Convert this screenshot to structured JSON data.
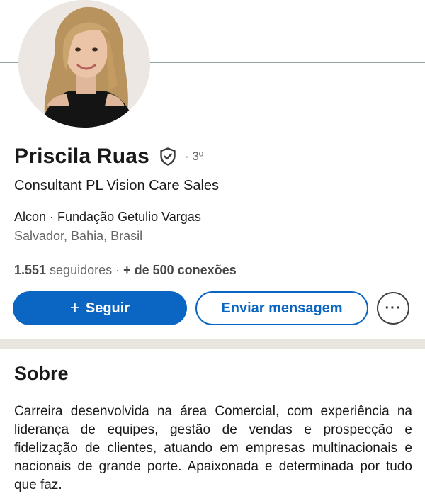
{
  "profile": {
    "name": "Priscila Ruas",
    "degree": "· 3º",
    "headline": "Consultant PL Vision Care Sales",
    "company": "Alcon · Fundação Getulio Vargas",
    "location": "Salvador, Bahia, Brasil",
    "followers_count": "1.551",
    "followers_label": " seguidores · ",
    "connections": "+ de 500 conexões"
  },
  "actions": {
    "follow_plus": "+",
    "follow_label": "Seguir",
    "message_label": "Enviar mensagem",
    "more_label": "···"
  },
  "about": {
    "title": "Sobre",
    "text": "Carreira desenvolvida na área Comercial, com experiência na liderança de equipes, gestão de vendas e prospecção e fidelização de clientes, atuando em empresas multinacionais e nacionais de grande porte. Apaixonada e determinada por tudo que faz."
  },
  "colors": {
    "brand_blue": "#0a66c2",
    "text_primary": "#191919",
    "text_secondary": "#666666",
    "section_divider": "#e9e5df"
  },
  "icons": {
    "verified": "shield-check-icon",
    "more": "ellipsis-icon"
  }
}
